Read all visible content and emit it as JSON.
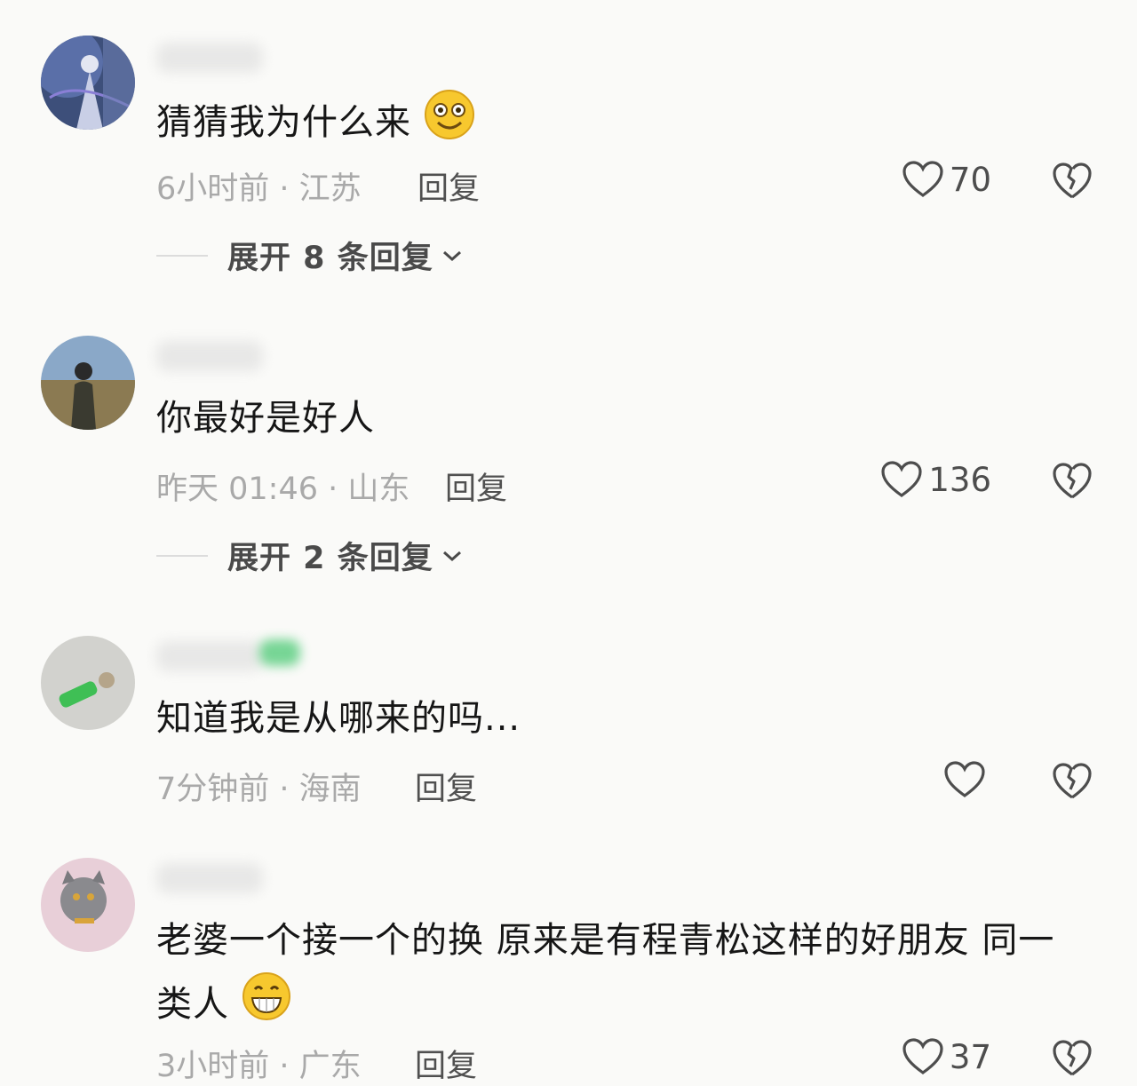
{
  "comments": [
    {
      "text": "猜猜我为什么来",
      "emoji": "smiling-emoji",
      "meta": "6小时前 · 江苏",
      "reply_label": "回复",
      "likes": "70",
      "expand_label": "展开 8 条回复"
    },
    {
      "text": "你最好是好人",
      "meta": "昨天 01:46 · 山东",
      "reply_label": "回复",
      "likes": "136",
      "expand_label": "展开 2 条回复"
    },
    {
      "text": "知道我是从哪来的吗...",
      "meta": "7分钟前 · 海南",
      "reply_label": "回复",
      "likes": ""
    },
    {
      "text": "老婆一个接一个的换 原来是有程青松这样的好朋友 同一类人",
      "emoji": "grinning-emoji",
      "meta": "3小时前 · 广东",
      "reply_label": "回复",
      "likes": "37"
    }
  ],
  "icons": {
    "like": "heart-outline-icon",
    "dislike": "broken-heart-icon",
    "expand": "chevron-down-icon"
  },
  "colors": {
    "background": "#fafaf8",
    "text": "#161616",
    "meta": "#a9a9a9",
    "action": "#505050"
  }
}
